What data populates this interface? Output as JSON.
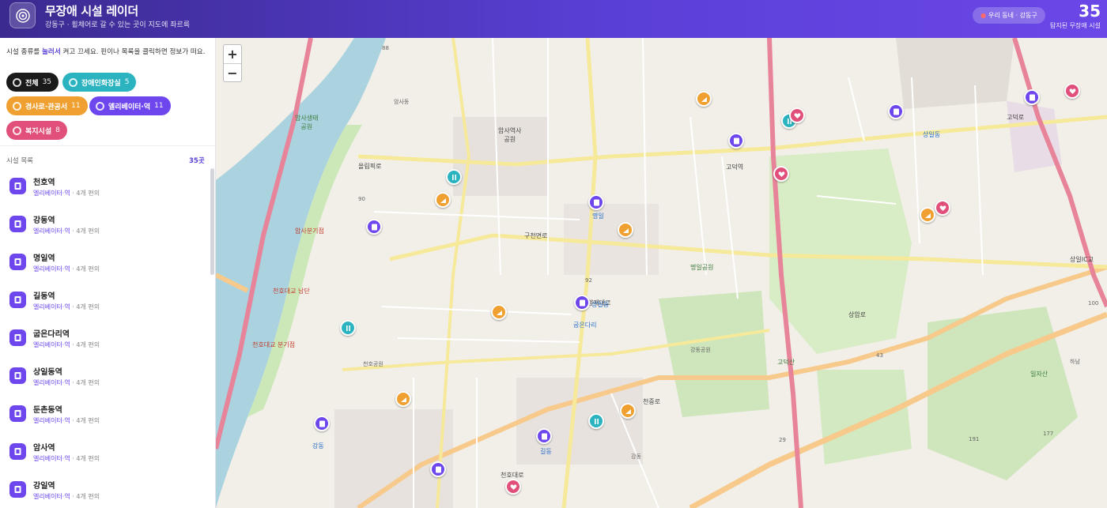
{
  "header": {
    "title": "무장애 시설 레이더",
    "subtitle": "강동구 · 휠체어로 갈 수 있는 곳이 지도에 좌르륵",
    "location_button": "우리 동네 · 강동구",
    "count": "35",
    "count_label": "탐지된 무장애 시설"
  },
  "sidebar": {
    "hint_pre": "시설 종류를 ",
    "hint_bold": "눌러서",
    "hint_post": " 켜고 끄세요. 핀이나 목록을 클릭하면 정보가 떠요.",
    "chips": [
      {
        "label": "전체",
        "count": "35",
        "color": "#1a1a1a"
      },
      {
        "label": "장애인화장실",
        "count": "5",
        "color": "#2bb3c0"
      },
      {
        "label": "경사로·관공서",
        "count": "11",
        "color": "#f0a030"
      },
      {
        "label": "엘리베이터·역",
        "count": "11",
        "color": "#6d46ee"
      },
      {
        "label": "복지시설",
        "count": "8",
        "color": "#e0507a"
      }
    ],
    "list_heading": "시설 목록",
    "list_count": "35곳",
    "items": [
      {
        "name": "천호역",
        "category": "엘리베이터·역",
        "detail": "4개 편의"
      },
      {
        "name": "강동역",
        "category": "엘리베이터·역",
        "detail": "4개 편의"
      },
      {
        "name": "명일역",
        "category": "엘리베이터·역",
        "detail": "4개 편의"
      },
      {
        "name": "길동역",
        "category": "엘리베이터·역",
        "detail": "4개 편의"
      },
      {
        "name": "굽은다리역",
        "category": "엘리베이터·역",
        "detail": "4개 편의"
      },
      {
        "name": "상일동역",
        "category": "엘리베이터·역",
        "detail": "4개 편의"
      },
      {
        "name": "둔촌동역",
        "category": "엘리베이터·역",
        "detail": "4개 편의"
      },
      {
        "name": "암사역",
        "category": "엘리베이터·역",
        "detail": "4개 편의"
      },
      {
        "name": "강일역",
        "category": "엘리베이터·역",
        "detail": "4개 편의"
      }
    ]
  },
  "map": {
    "zoom_in": "+",
    "zoom_out": "−",
    "labels": {
      "amsa_park": "암사생태\n공원",
      "amsadong": "암사동",
      "amsa_station": "암사역사\n공원",
      "cheonho_park": "천호공원",
      "gangdong_park": "강동공원",
      "godeok_station": "고덕역",
      "sangil": "상일동",
      "gangdong_gu": "강동",
      "cheonho_daero": "천호대로",
      "cheonjung_ro": "천중로",
      "gucheonmyeon_ro": "구천면로",
      "yangjae_daero": "양재대로",
      "sangam_ro": "상암로",
      "godeok_ro": "고덕로",
      "olympic_ro": "올림픽로",
      "myeongil_park": "명일공원",
      "godeok_san": "고덕산",
      "ilja_san": "일자산",
      "gangil_ic": "상일IC교",
      "hanam": "하남",
      "road88": "88",
      "road90": "90",
      "road92": "92",
      "road43": "43",
      "road29": "29",
      "road100": "100",
      "road191": "191",
      "road177": "177",
      "cheonho_gyo": "천호대교 남단",
      "amsa_gija": "암사분기점",
      "gudeok_gijeom": "천호대교 분기점",
      "gangdong_station_lbl": "강동",
      "gildong_station_lbl": "길동",
      "gubeundari_lbl": "굽은다리",
      "myeongil_lbl": "명일",
      "sangil_lbl": "상일동"
    }
  },
  "colors": {
    "header_start": "#3b2a8f",
    "header_end": "#6b47e8",
    "accent": "#5a3fd6",
    "elevator": "#6d46ee",
    "restroom": "#2bb3c0",
    "ramp": "#f0a030",
    "welfare": "#e0507a"
  }
}
